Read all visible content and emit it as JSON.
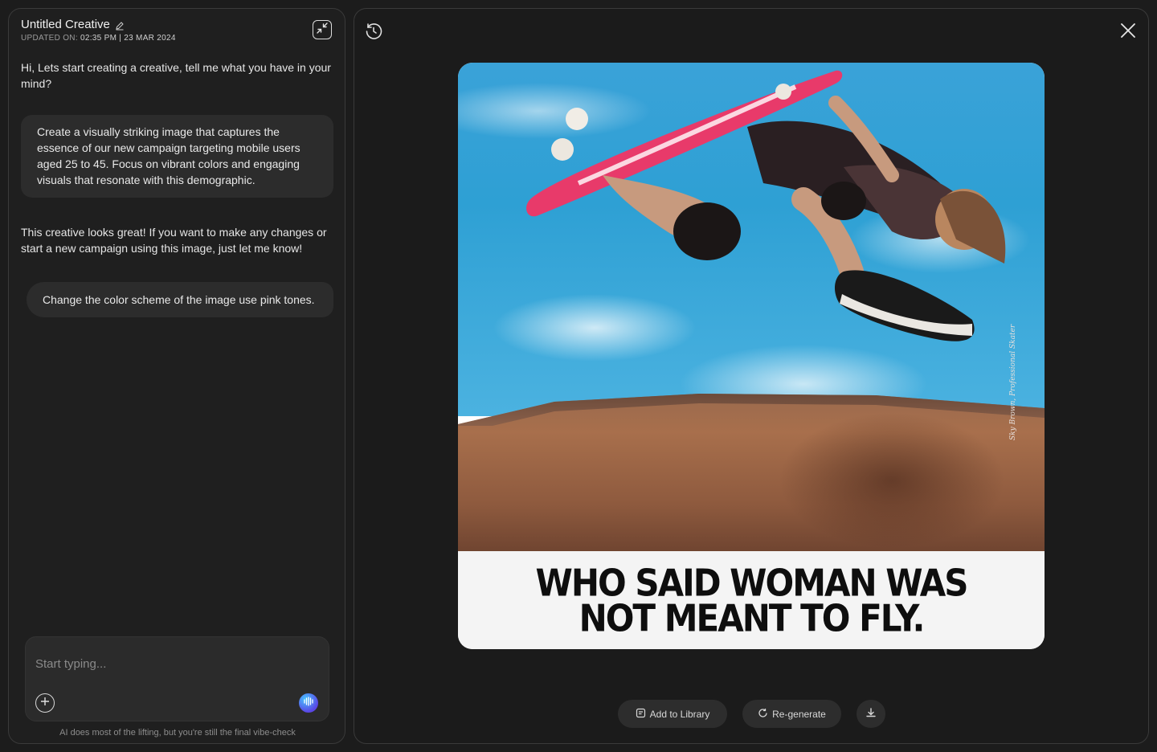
{
  "sidebar": {
    "title": "Untitled Creative",
    "updated_label": "UPDATED ON:",
    "updated_value": "02:35 PM | 23 MAR 2024",
    "messages": [
      {
        "role": "ai",
        "text": "Hi, Lets start creating a creative, tell me what you have in your mind?"
      },
      {
        "role": "user",
        "text": "Create a visually striking image that captures the essence of our new campaign targeting mobile users aged 25 to 45. Focus on vibrant colors and engaging visuals that resonate with this demographic."
      },
      {
        "role": "ai",
        "text": "This creative looks great! If you want to make any changes or start a new campaign using this image, just let me know!"
      },
      {
        "role": "user",
        "text": "Change the color scheme of the image use pink tones."
      }
    ],
    "composer": {
      "placeholder": "Start typing..."
    },
    "disclaimer": "AI does most of the lifting, but you're still the final vibe-check"
  },
  "preview": {
    "headline_line1": "WHO SAID WOMAN WAS",
    "headline_line2": "NOT MEANT TO FLY.",
    "credit": "Sky Brown, Professional Skater",
    "actions": {
      "add_to_library": "Add to Library",
      "regenerate": "Re-generate"
    }
  },
  "icons": [
    "edit-icon",
    "collapse-icon",
    "plus-icon",
    "voice-icon",
    "history-icon",
    "close-icon",
    "library-icon",
    "refresh-icon",
    "download-icon"
  ]
}
